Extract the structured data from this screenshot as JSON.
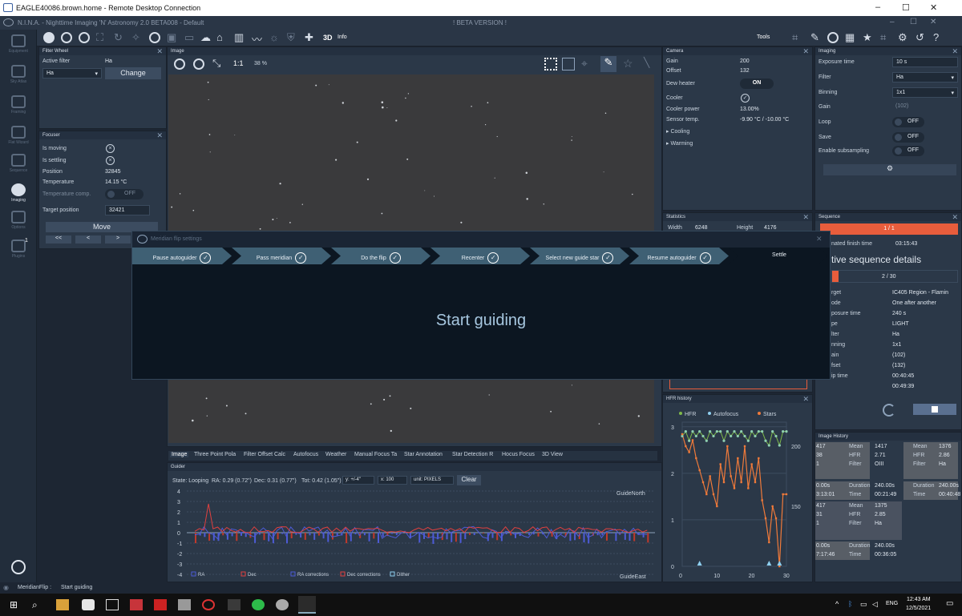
{
  "rdp": {
    "title": "EAGLE40086.brown.home - Remote Desktop Connection",
    "min": "–",
    "max": "☐",
    "close": "✕"
  },
  "app": {
    "title": "N.I.N.A. - Nighttime Imaging 'N' Astronomy 2.0 BETA008 - Default",
    "beta": "! BETA VERSION !",
    "info3d": "3D",
    "info": "Info",
    "tools": "Tools"
  },
  "nav": [
    {
      "label": "Equipment"
    },
    {
      "label": "Sky Atlas"
    },
    {
      "label": "Framing"
    },
    {
      "label": "Flat Wizard"
    },
    {
      "label": "Sequence"
    },
    {
      "label": "Imaging"
    },
    {
      "label": "Options"
    },
    {
      "label": "Plugins"
    }
  ],
  "plugins_badge": "1",
  "filterwheel": {
    "title": "Filter Wheel",
    "active_label": "Active filter",
    "active_value": "Ha",
    "select": "Ha",
    "change": "Change"
  },
  "focuser": {
    "title": "Focuser",
    "is_moving": "Is moving",
    "is_settling": "Is settling",
    "position_label": "Position",
    "position": "32845",
    "temp_label": "Temperature",
    "temp": "14.15 °C",
    "tcomp_label": "Temperature comp.",
    "tcomp": "OFF",
    "target_label": "Target position",
    "target": "32421",
    "move": "Move",
    "b1": "<<",
    "b2": "<",
    "b3": ">"
  },
  "image": {
    "title": "Image",
    "zoom": "1:1",
    "zoom_pct": "38 %"
  },
  "camera": {
    "title": "Camera",
    "gain_label": "Gain",
    "gain": "200",
    "offset_label": "Offset",
    "offset": "132",
    "dew_label": "Dew heater",
    "dew": "ON",
    "cooler_label": "Cooler",
    "cpower_label": "Cooler power",
    "cpower": "13.00%",
    "stemp_label": "Sensor temp.",
    "stemp": "-9.90 °C / -10.00 °C",
    "cooling": "Cooling",
    "warming": "Warming"
  },
  "imaging": {
    "title": "Imaging",
    "exp_label": "Exposure time",
    "exp": "10",
    "exp_unit": "s",
    "filter_label": "Filter",
    "filter": "Ha",
    "bin_label": "Binning",
    "bin": "1x1",
    "gain_label": "Gain",
    "gain": "(102)",
    "loop_label": "Loop",
    "loop": "OFF",
    "save_label": "Save",
    "save": "OFF",
    "sub_label": "Enable subsampling",
    "sub": "OFF"
  },
  "statistics": {
    "title": "Statistics",
    "w_label": "Width",
    "w": "6248",
    "h_label": "Height",
    "h": "4176"
  },
  "sequence": {
    "title": "Sequence",
    "progress": "1 / 1",
    "finish_label": "nated finish time",
    "finish": "03:15:43",
    "details": "tive sequence details",
    "sub_progress": "2 / 30",
    "rows": [
      {
        "k": "rget",
        "v": "IC405 Region - Flamin"
      },
      {
        "k": "ode",
        "v": "One after another"
      },
      {
        "k": "posure time",
        "v": "240 s"
      },
      {
        "k": "pe",
        "v": "LIGHT"
      },
      {
        "k": "lter",
        "v": "Ha"
      },
      {
        "k": "nning",
        "v": "1x1"
      },
      {
        "k": "ain",
        "v": "(102)"
      },
      {
        "k": "fset",
        "v": "(132)"
      },
      {
        "k": "ip time",
        "v": "00:40:45"
      },
      {
        "k": "",
        "v": "00:49:39"
      }
    ]
  },
  "hfr": {
    "title": "HFR history",
    "legend_hfr": "HFR",
    "legend_af": "Autofocus",
    "legend_stars": "Stars"
  },
  "history": {
    "title": "Image History",
    "cells": [
      {
        "a": "Mean",
        "b": "1417",
        "c": "HFR",
        "d": "2.71",
        "e": "Filter",
        "f": "OIII",
        "pre1": "417",
        "pre2": "38",
        "pre3": "1"
      },
      {
        "a": "Mean",
        "b": "1376",
        "c": "HFR",
        "d": "2.86",
        "e": "Filter",
        "f": "Ha"
      },
      {
        "a": "Duration",
        "b": "240.00s",
        "c": "Time",
        "d": "00:21:49",
        "pre1": "0.00s",
        "pre2": "3:13:01"
      },
      {
        "a": "Duration",
        "b": "240.00s",
        "c": "Time",
        "d": "00:40:48"
      },
      {
        "a": "Mean",
        "b": "1375",
        "c": "HFR",
        "d": "2.85",
        "e": "Filter",
        "f": "Ha",
        "pre1": "417",
        "pre2": "31",
        "pre3": "1"
      },
      {
        "a": "Duration",
        "b": "240.00s",
        "c": "Time",
        "d": "00:36:05",
        "pre1": "0.00s",
        "pre2": "7:17:46"
      }
    ]
  },
  "tabs": [
    "Image",
    "Three Point Pola",
    "Filter Offset Calc",
    "Autofocus",
    "Weather",
    "Manual Focus Ta",
    "Star Annotation",
    "Star Detection R",
    "Hocus Focus",
    "3D View"
  ],
  "guider": {
    "title": "Guider",
    "state": "State: Looping",
    "ra": "RA: 0.29 (0.72\")",
    "dec": "Dec: 0.31 (0.77\")",
    "tot": "Tot: 0.42 (1.05\")",
    "y": "y: +/-4\"",
    "x": "x: 100",
    "unit": "unit: PIXELS",
    "clear": "Clear",
    "north": "GuideNorth",
    "east": "GuideEast",
    "legend": [
      "RA",
      "Dec",
      "RA corrections",
      "Dec corrections",
      "Dither"
    ],
    "yticks": [
      "4",
      "3",
      "2",
      "1",
      "0",
      "-1",
      "-2",
      "-3",
      "-4"
    ]
  },
  "modal": {
    "title": "Meridian flip settings",
    "steps": [
      "Pause autoguider",
      "Pass meridian",
      "Do the flip",
      "Recenter",
      "Select new guide star",
      "Resume autoguider",
      "Settle"
    ],
    "message": "Start guiding"
  },
  "statusbar": {
    "left": "MeridianFlip :",
    "right": "Start guiding"
  },
  "taskbar": {
    "lang": "ENG",
    "time": "12:43 AM",
    "date": "12/5/2021"
  },
  "chart_data": [
    {
      "type": "line",
      "title": "HFR history",
      "x": [
        0,
        1,
        2,
        3,
        4,
        5,
        6,
        7,
        8,
        9,
        10,
        11,
        12,
        13,
        14,
        15,
        16,
        17,
        18,
        19,
        20,
        21,
        22,
        23,
        24,
        25,
        26,
        27,
        28,
        29,
        30
      ],
      "series": [
        {
          "name": "HFR",
          "values": [
            2.8,
            2.9,
            2.7,
            2.9,
            2.8,
            2.9,
            2.8,
            2.7,
            2.9,
            2.8,
            2.9,
            2.9,
            2.7,
            2.9,
            2.8,
            2.9,
            2.8,
            2.9,
            2.8,
            2.7,
            2.9,
            2.8,
            2.9,
            2.9,
            2.7,
            2.6,
            2.9,
            2.8,
            2.6,
            2.9,
            2.9
          ]
        },
        {
          "name": "Stars",
          "values": [
            210,
            200,
            195,
            205,
            190,
            180,
            170,
            160,
            175,
            160,
            150,
            185,
            170,
            200,
            175,
            165,
            190,
            170,
            200,
            165,
            185,
            170,
            190,
            155,
            140,
            120,
            150,
            140,
            100,
            160,
            160
          ]
        }
      ],
      "autofocus_x": [
        5,
        25,
        28
      ],
      "ylim": [
        0,
        3.1
      ],
      "y2ticks": [
        150,
        200
      ],
      "xticks": [
        0,
        10,
        20,
        30
      ]
    }
  ]
}
